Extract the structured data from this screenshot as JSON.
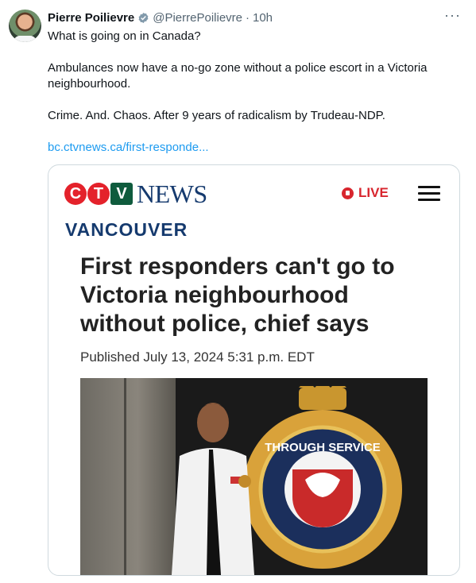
{
  "tweet": {
    "author_name": "Pierre Poilievre",
    "handle": "@PierrePoilievre",
    "separator": "·",
    "time": "10h",
    "more": "···",
    "line1": "What is going on in Canada?",
    "line2": "Ambulances now have a no-go zone without a police escort in a Victoria neighbourhood.",
    "line3": "Crime. And. Chaos. After 9 years of radicalism by Trudeau-NDP.",
    "link": "bc.ctvnews.ca/first-responde..."
  },
  "card": {
    "logo_c": "C",
    "logo_t": "T",
    "logo_v": "V",
    "logo_news": "NEWS",
    "live_label": "LIVE",
    "region": "VANCOUVER",
    "headline": "First responders can't go to Victoria neighbourhood without police, chief says",
    "published": "Published July 13, 2024 5:31 p.m. EDT",
    "crest_text": "THROUGH SERVICE"
  },
  "colors": {
    "link": "#1d9bf0",
    "verified": "#829aab",
    "ctv_red": "#e4222b",
    "ctv_navy": "#153a6e",
    "live_red": "#d8262e"
  },
  "icons": [
    "verified-badge-icon",
    "more-icon",
    "live-icon",
    "menu-icon"
  ]
}
